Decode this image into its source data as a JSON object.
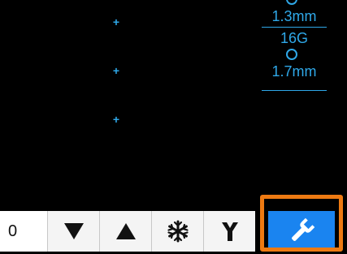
{
  "needle_panel": {
    "top_size": "1.3mm",
    "gauge": "16G",
    "bottom_size": "1.7mm"
  },
  "toolbar": {
    "value": "0",
    "buttons": [
      {
        "icon": "triangle-down-icon"
      },
      {
        "icon": "triangle-up-icon"
      },
      {
        "icon": "snowflake-icon"
      },
      {
        "icon": "y-connector-icon"
      },
      {
        "icon": "wrench-icon"
      }
    ]
  },
  "colors": {
    "accent_text": "#2fa8e8",
    "selected_button": "#1a84f0",
    "highlight_frame": "#ee7a12"
  }
}
